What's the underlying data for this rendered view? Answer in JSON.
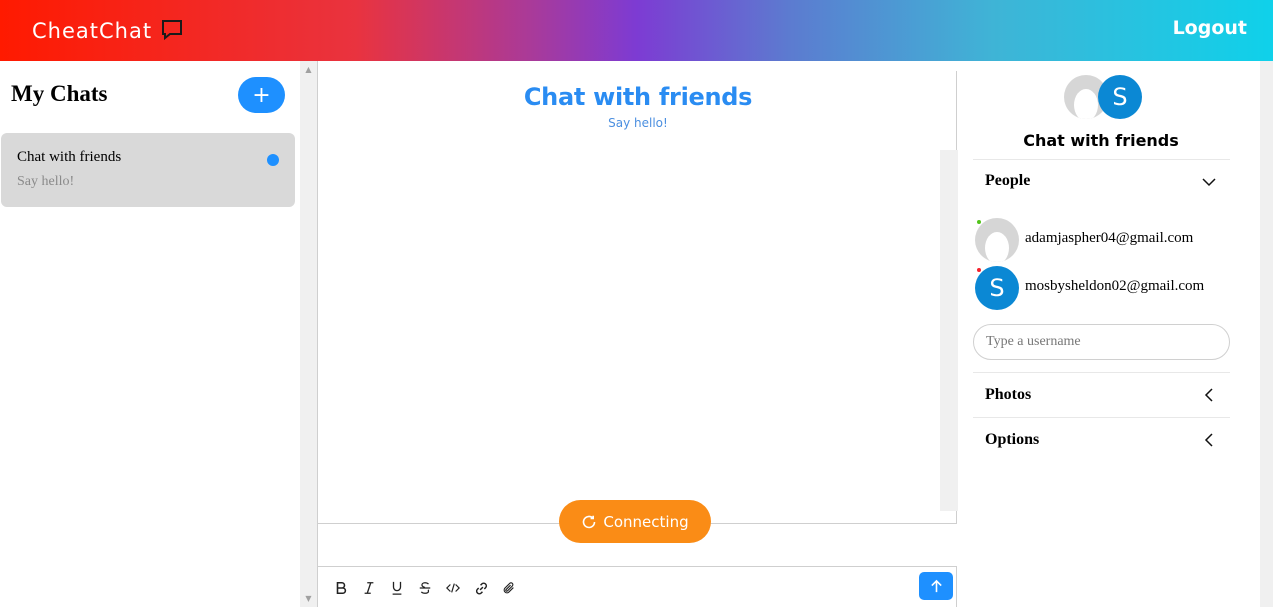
{
  "header": {
    "brand": "CheatChat",
    "logout": "Logout",
    "gradient_colors": [
      "#ff1a00",
      "#e9333f",
      "#7d3bd3",
      "#0fd1ea"
    ]
  },
  "sidebar": {
    "title": "My Chats",
    "add_label": "+",
    "chats": [
      {
        "title": "Chat with friends",
        "subtitle": "Say hello!",
        "unread": true
      }
    ]
  },
  "chat": {
    "title": "Chat with friends",
    "subtitle": "Say hello!",
    "status": "Connecting",
    "toolbar_icons": [
      "bold-icon",
      "italic-icon",
      "underline-icon",
      "strikethrough-icon",
      "code-icon",
      "link-icon",
      "attachment-icon"
    ],
    "send_icon": "arrow-up-icon"
  },
  "details": {
    "title": "Chat with friends",
    "avatar_letter": "S",
    "people_label": "People",
    "people": [
      {
        "email": "adamjaspher04@gmail.com",
        "avatar": "default",
        "online": true
      },
      {
        "email": "mosbysheldon02@gmail.com",
        "avatar": "S",
        "online": false
      }
    ],
    "username_placeholder": "Type a username",
    "photos_label": "Photos",
    "options_label": "Options"
  },
  "colors": {
    "accent": "#1e90ff",
    "connecting": "#fa8c16",
    "avatar_blue": "#0b88d4",
    "online": "#52c41a",
    "offline": "#f5222d"
  }
}
